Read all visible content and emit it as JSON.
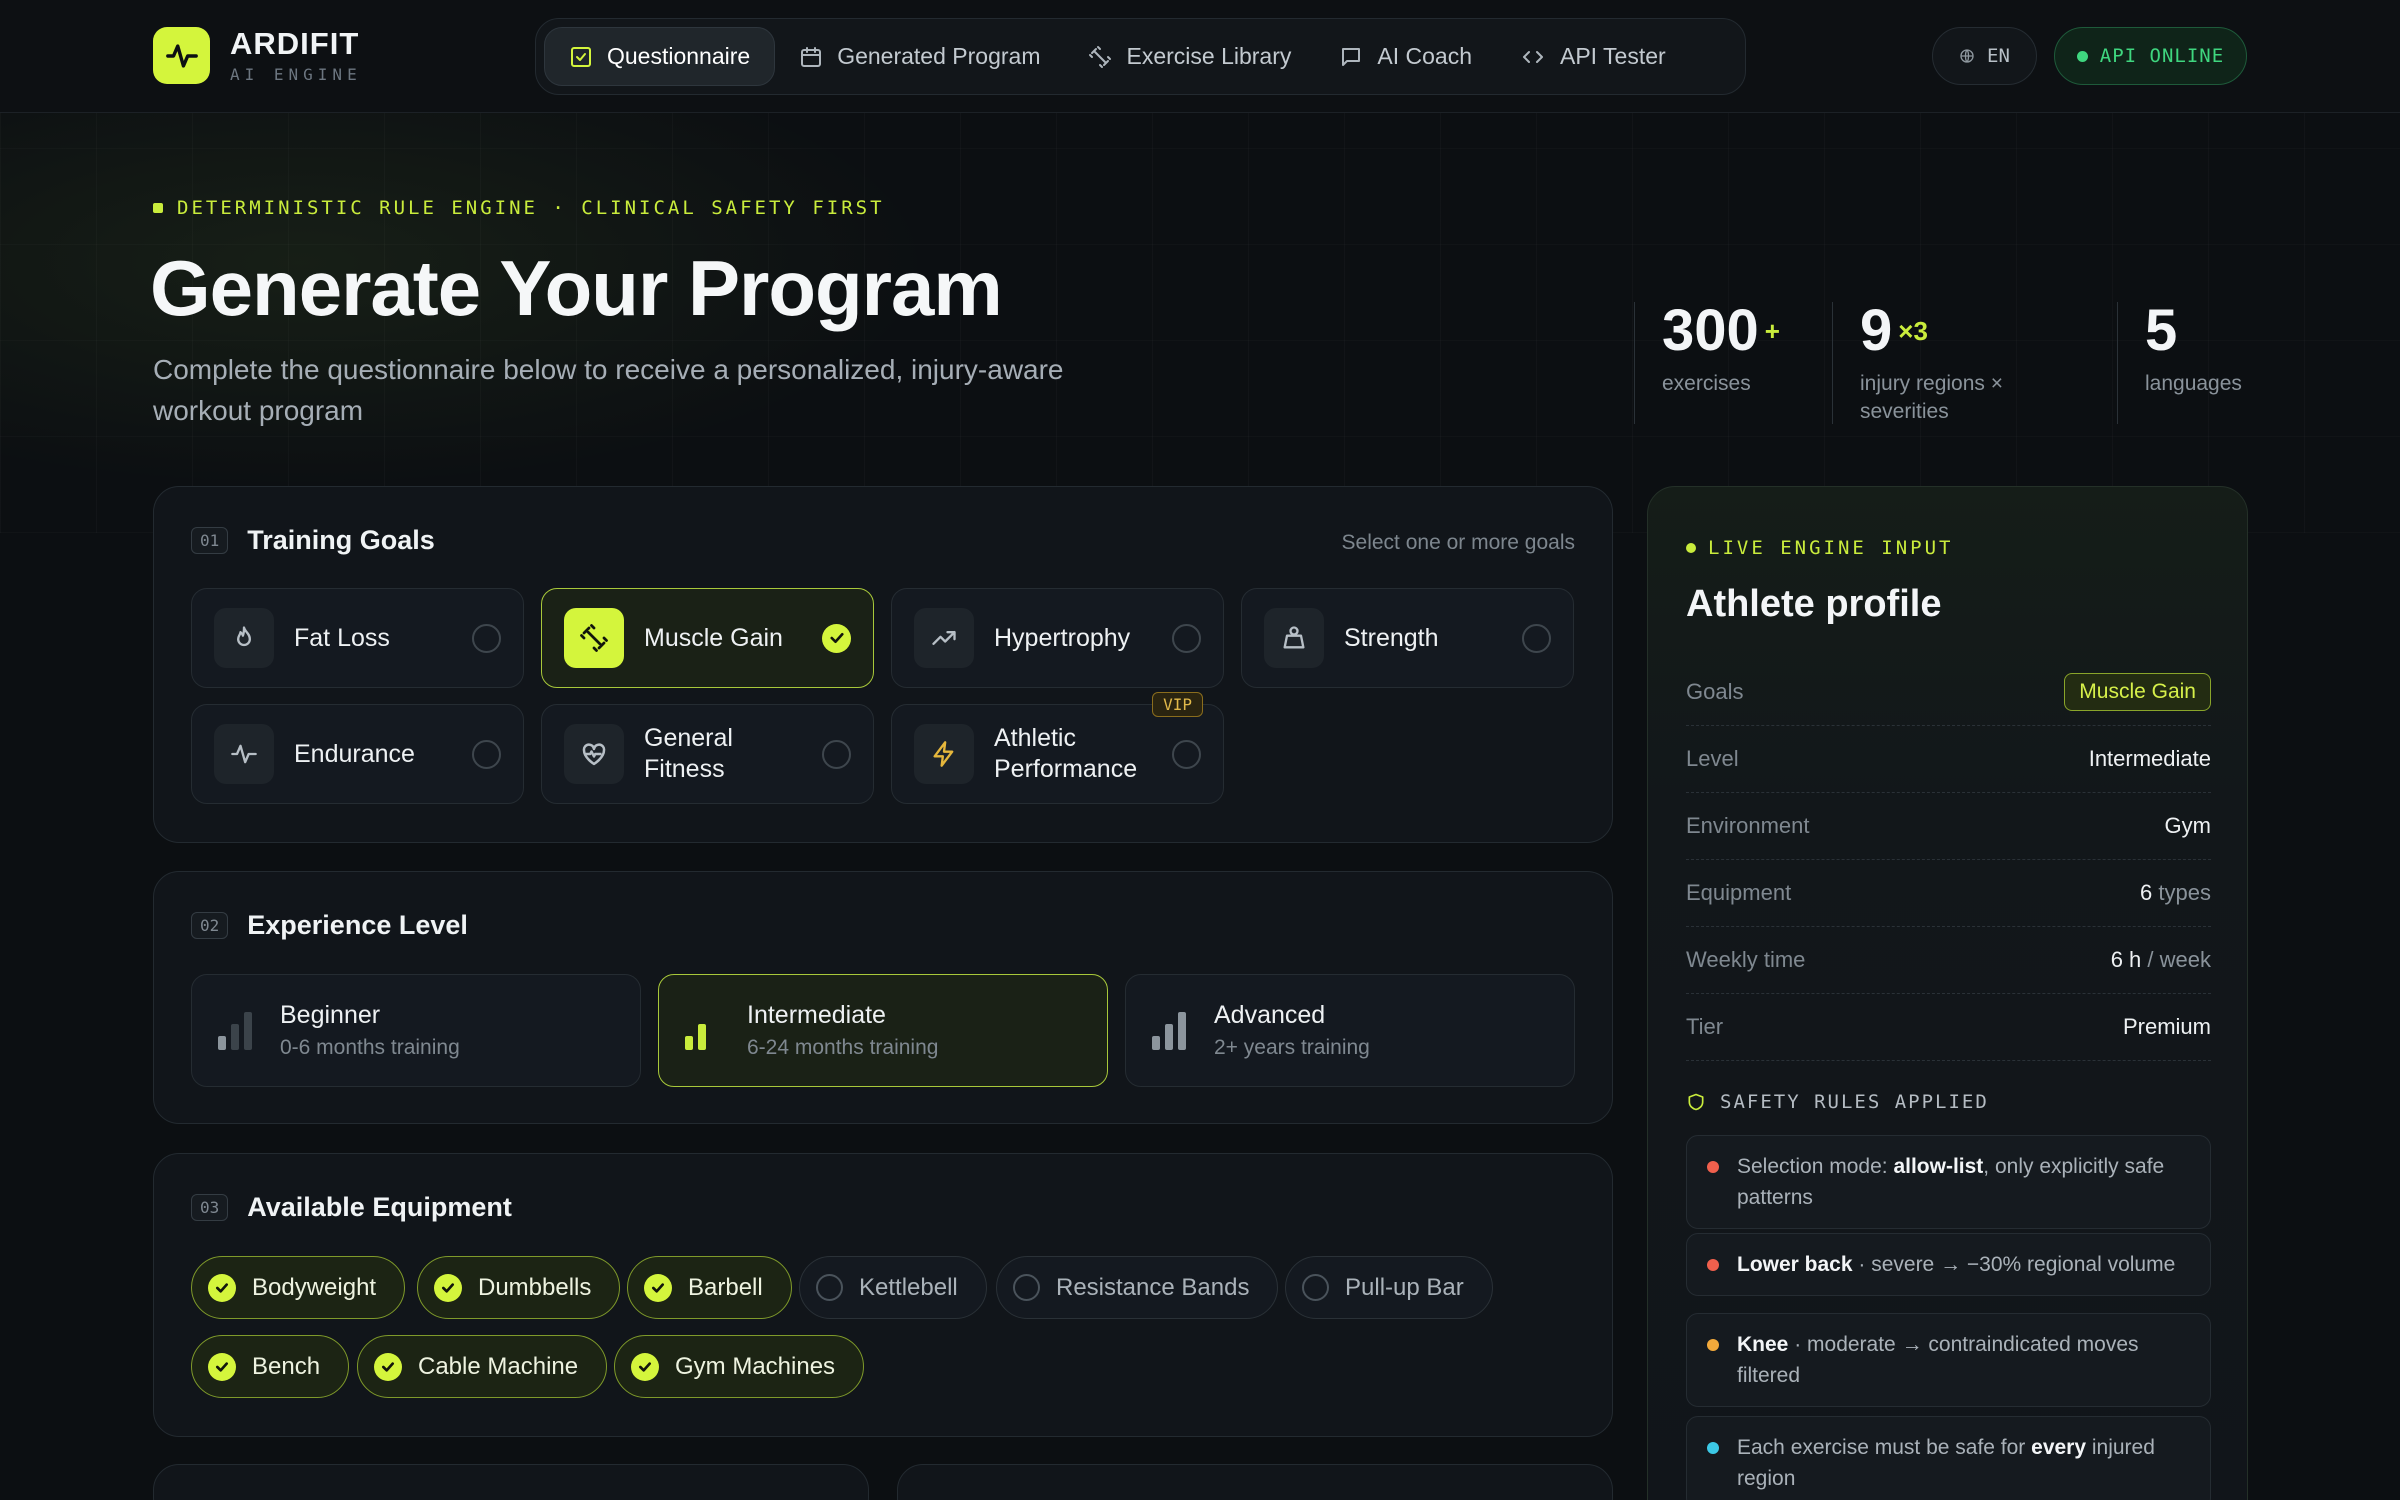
{
  "brand": {
    "name": "ARDIFIT",
    "subtitle": "AI ENGINE",
    "accent": "#d4f53c"
  },
  "nav": {
    "items": [
      {
        "label": "Questionnaire",
        "icon": "checkbox-icon",
        "active": true
      },
      {
        "label": "Generated Program",
        "icon": "calendar-icon",
        "active": false
      },
      {
        "label": "Exercise Library",
        "icon": "dumbbell-icon",
        "active": false
      },
      {
        "label": "AI Coach",
        "icon": "chat-icon",
        "active": false
      },
      {
        "label": "API Tester",
        "icon": "code-icon",
        "active": false
      }
    ]
  },
  "language": {
    "label": "EN"
  },
  "api": {
    "label": "API ONLINE",
    "color": "#3fd67f"
  },
  "hero": {
    "eyebrow": "DETERMINISTIC RULE ENGINE · CLINICAL SAFETY FIRST",
    "title": "Generate Your Program",
    "subtitle": "Complete the questionnaire below to receive a personalized, injury-aware workout program"
  },
  "stats": [
    {
      "value": "300",
      "suffix": "+",
      "label": "exercises"
    },
    {
      "value": "9",
      "suffix": "×3",
      "label": "injury regions × severities"
    },
    {
      "value": "5",
      "suffix": "",
      "label": "languages"
    }
  ],
  "goals": {
    "step": "01",
    "title": "Training Goals",
    "hint": "Select one or more goals",
    "items": [
      {
        "label": "Fat Loss",
        "icon": "flame-icon",
        "selected": false
      },
      {
        "label": "Muscle Gain",
        "icon": "dumbbell-icon",
        "selected": true
      },
      {
        "label": "Hypertrophy",
        "icon": "trending-up-icon",
        "selected": false
      },
      {
        "label": "Strength",
        "icon": "weight-icon",
        "selected": false
      },
      {
        "label": "Endurance",
        "icon": "pulse-icon",
        "selected": false
      },
      {
        "label": "General Fitness",
        "icon": "heart-pulse-icon",
        "selected": false
      },
      {
        "label": "Athletic Performance",
        "icon": "bolt-icon",
        "selected": false,
        "badge": "VIP"
      }
    ]
  },
  "experience": {
    "step": "02",
    "title": "Experience Level",
    "items": [
      {
        "label": "Beginner",
        "desc": "0-6 months training",
        "selected": false
      },
      {
        "label": "Intermediate",
        "desc": "6-24 months training",
        "selected": true
      },
      {
        "label": "Advanced",
        "desc": "2+ years training",
        "selected": false
      }
    ]
  },
  "equipment": {
    "step": "03",
    "title": "Available Equipment",
    "items": [
      {
        "label": "Bodyweight",
        "selected": true
      },
      {
        "label": "Dumbbells",
        "selected": true
      },
      {
        "label": "Barbell",
        "selected": true
      },
      {
        "label": "Kettlebell",
        "selected": false
      },
      {
        "label": "Resistance Bands",
        "selected": false
      },
      {
        "label": "Pull-up Bar",
        "selected": false
      },
      {
        "label": "Bench",
        "selected": true
      },
      {
        "label": "Cable Machine",
        "selected": true
      },
      {
        "label": "Gym Machines",
        "selected": true
      }
    ]
  },
  "profile": {
    "eyebrow": "LIVE ENGINE INPUT",
    "title": "Athlete profile",
    "rows": [
      {
        "key": "Goals",
        "value": "Muscle Gain"
      },
      {
        "key": "Level",
        "value": "Intermediate"
      },
      {
        "key": "Environment",
        "value": "Gym"
      },
      {
        "key": "Equipment",
        "value": "6",
        "unit": "types"
      },
      {
        "key": "Weekly time",
        "value": "6 h",
        "unit": "/ week"
      },
      {
        "key": "Tier",
        "value": "Premium"
      }
    ],
    "safety_title": "SAFETY RULES APPLIED",
    "rules": [
      {
        "color": "#f0604d",
        "pre": "Selection mode: ",
        "bold": "allow-list",
        "post": ", only explicitly safe patterns"
      },
      {
        "color": "#f0604d",
        "pre": "",
        "bold": "Lower back",
        "post": " · severe → −30% regional volume"
      },
      {
        "color": "#f2a93b",
        "pre": "",
        "bold": "Knee",
        "post": " · moderate → contraindicated moves filtered"
      },
      {
        "color": "#3cc9e6",
        "pre": "Each exercise must be safe for ",
        "bold": "every",
        "post": " injured region"
      }
    ]
  }
}
